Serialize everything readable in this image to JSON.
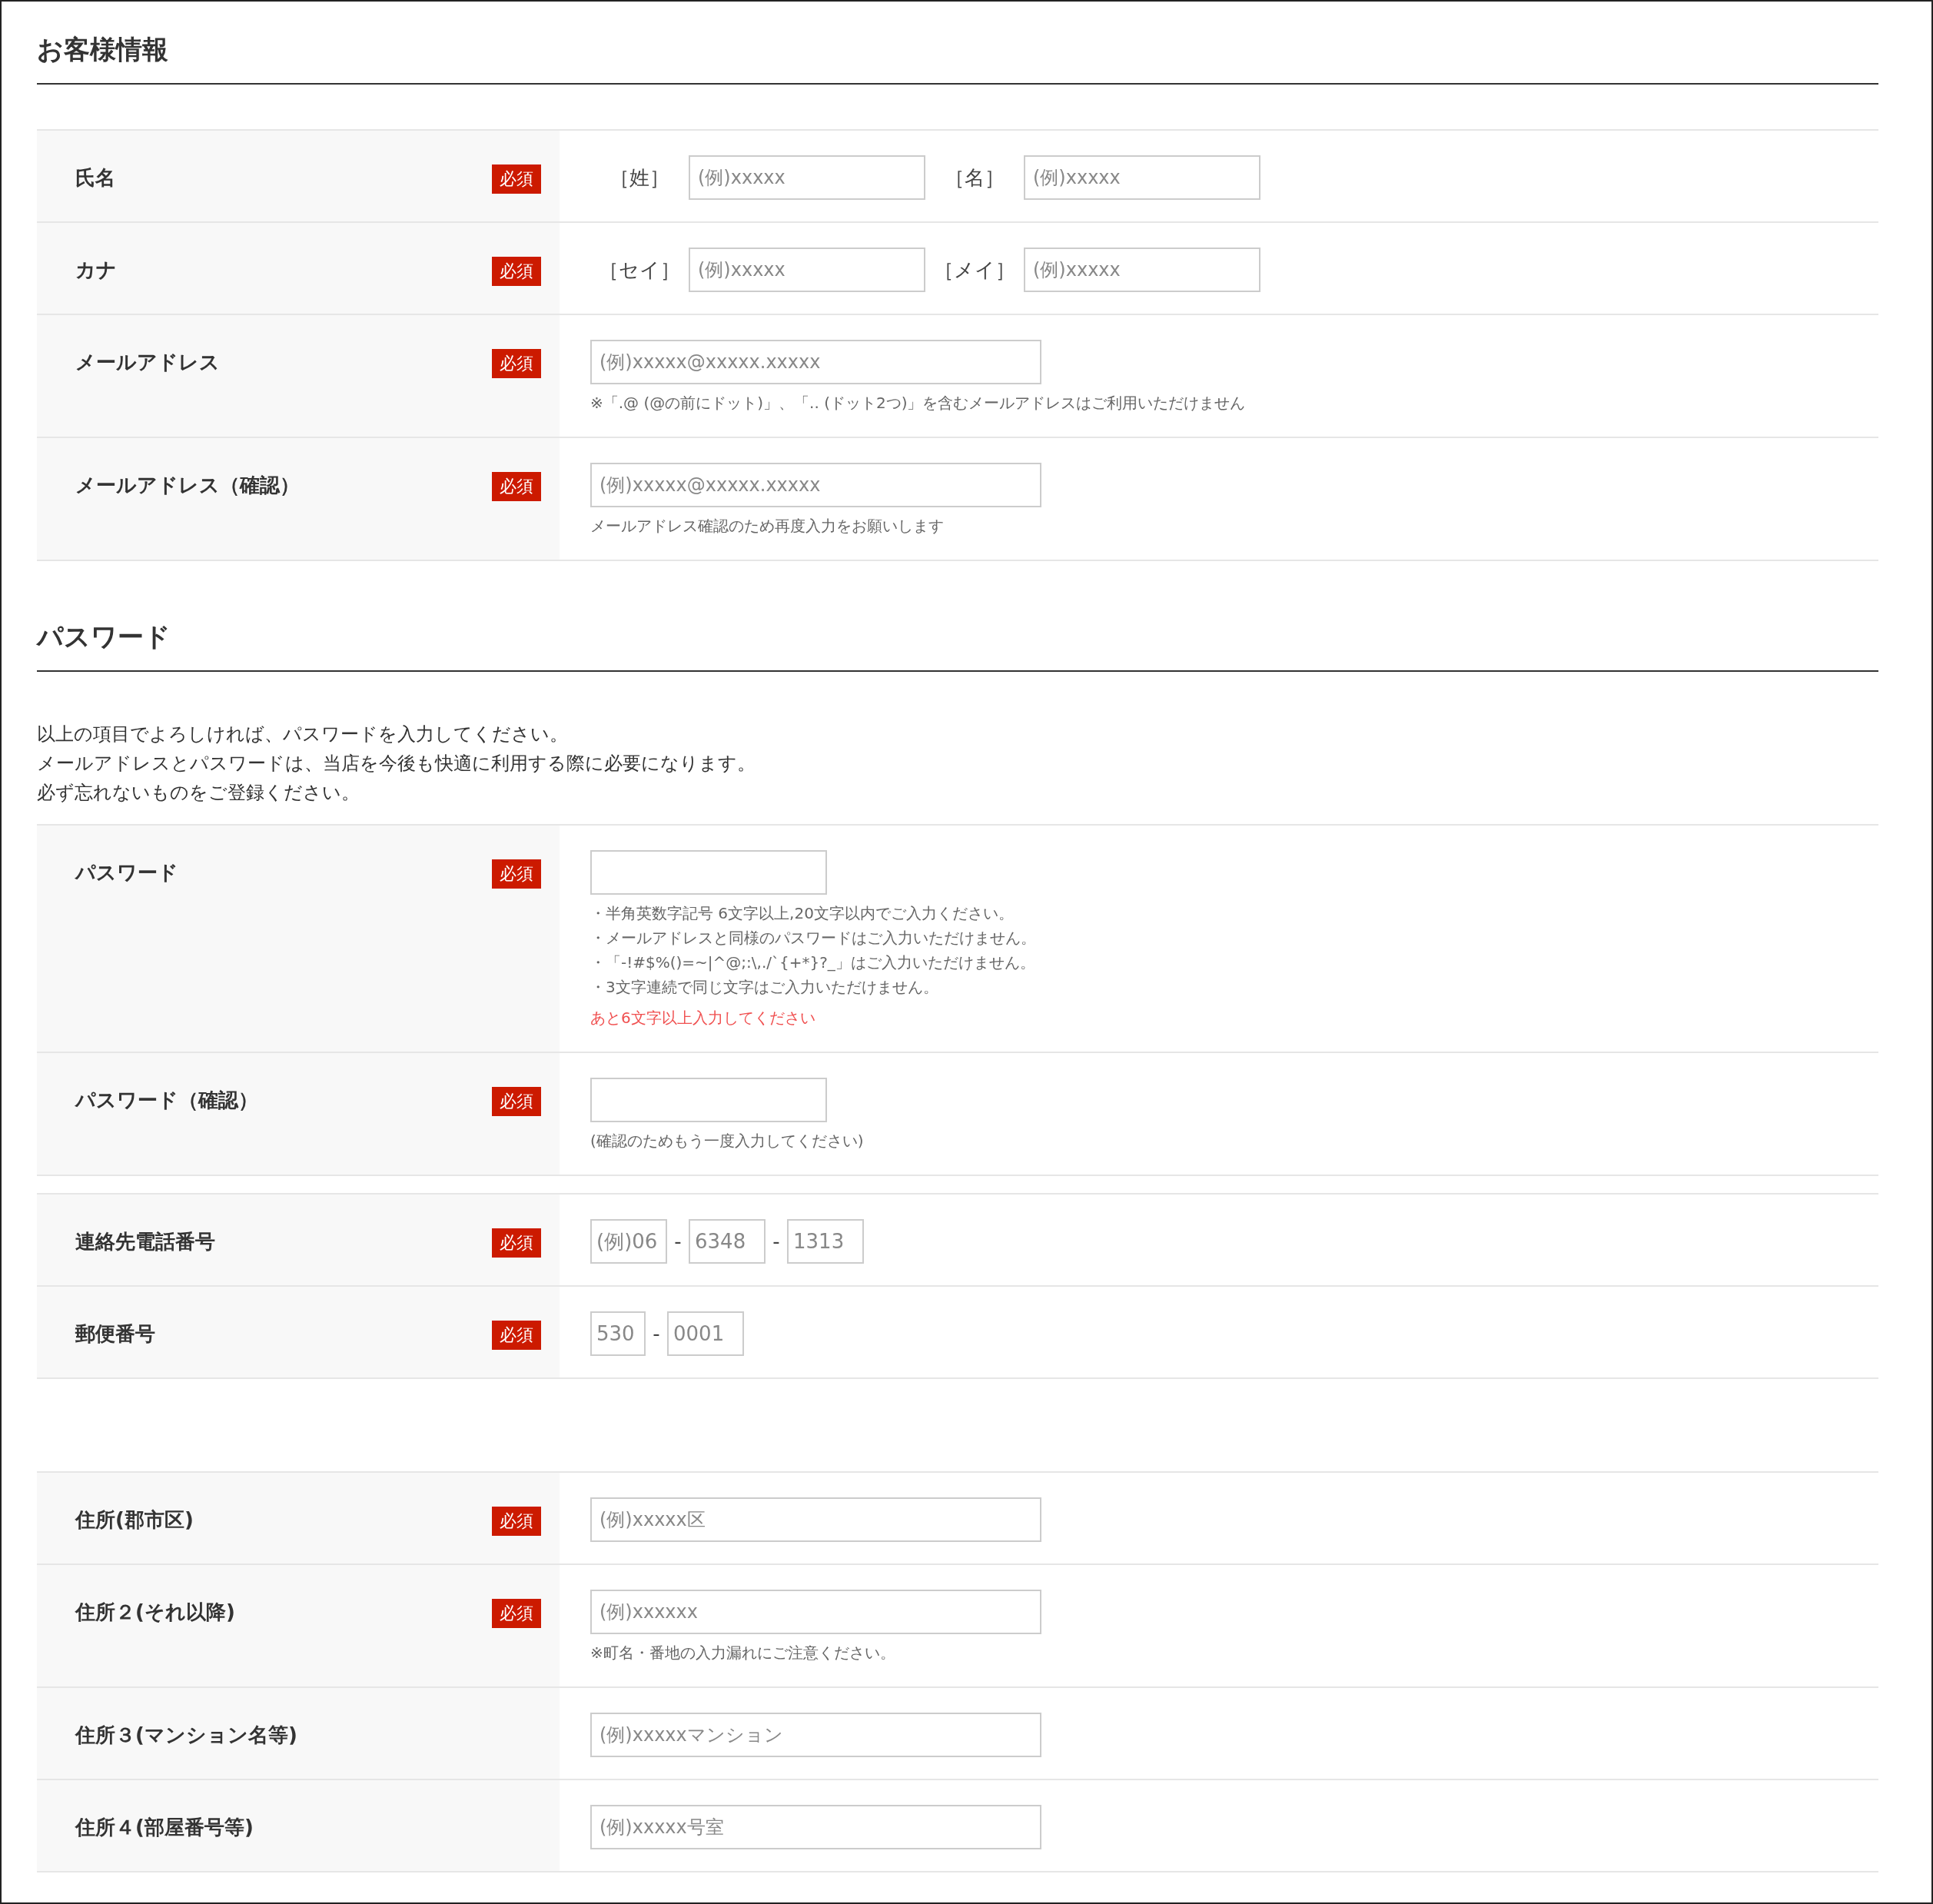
{
  "sections": [
    {
      "heading": "お客様情報",
      "groups": [
        {
          "rows": [
            {
              "label": "氏名",
              "badge": "必須",
              "items": [
                {
                  "kind": "prefix",
                  "text": "［姓］"
                },
                {
                  "kind": "medium",
                  "placeholder": "(例)xxxxx"
                },
                {
                  "kind": "prefix",
                  "text": "［名］"
                },
                {
                  "kind": "medium",
                  "placeholder": "(例)xxxxx"
                }
              ]
            },
            {
              "label": "カナ",
              "badge": "必須",
              "items": [
                {
                  "kind": "prefix",
                  "text": "［セイ］"
                },
                {
                  "kind": "medium",
                  "placeholder": "(例)xxxxx"
                },
                {
                  "kind": "prefix",
                  "text": "［メイ］"
                },
                {
                  "kind": "medium",
                  "placeholder": "(例)xxxxx"
                }
              ]
            },
            {
              "label": "メールアドレス",
              "badge": "必須",
              "items": [
                {
                  "kind": "wide",
                  "placeholder": "(例)xxxxx@xxxxx.xxxxx"
                }
              ],
              "notes": [
                {
                  "kind": "note",
                  "text": "※「.@ (@の前にドット)」、「.. (ドット2つ)」を含むメールアドレスはご利用いただけません"
                }
              ]
            },
            {
              "label": "メールアドレス（確認）",
              "badge": "必須",
              "items": [
                {
                  "kind": "wide",
                  "placeholder": "(例)xxxxx@xxxxx.xxxxx"
                }
              ],
              "notes": [
                {
                  "kind": "note",
                  "text": "メールアドレス確認のため再度入力をお願いします"
                }
              ]
            }
          ]
        }
      ]
    },
    {
      "heading": "パスワード",
      "intro": [
        "以上の項目でよろしければ、パスワードを入力してください。",
        "メールアドレスとパスワードは、当店を今後も快適に利用する際に必要になります。",
        "必ず忘れないものをご登録ください。"
      ],
      "groups": [
        {
          "rows": [
            {
              "label": "パスワード",
              "badge": "必須",
              "items": [
                {
                  "kind": "medium"
                }
              ],
              "notes": [
                {
                  "kind": "note",
                  "text": "・半角英数字記号 6文字以上,20文字以内でご入力ください。"
                },
                {
                  "kind": "note",
                  "text": "・メールアドレスと同様のパスワードはご入力いただけません。"
                },
                {
                  "kind": "note",
                  "text": "・「-!#$%()=~|^@;:\\,./`{+*}?_」はご入力いただけません。"
                },
                {
                  "kind": "note",
                  "text": "・3文字連続で同じ文字はご入力いただけません。"
                },
                {
                  "kind": "error",
                  "text": "あと6文字以上入力してください"
                }
              ]
            },
            {
              "label": "パスワード（確認）",
              "badge": "必須",
              "items": [
                {
                  "kind": "medium"
                }
              ],
              "notes": [
                {
                  "kind": "note",
                  "text": "(確認のためもう一度入力してください)"
                }
              ]
            }
          ]
        },
        {
          "rows": [
            {
              "label": "連絡先電話番号",
              "badge": "必須",
              "items": [
                {
                  "kind": "short",
                  "placeholder": "(例)06"
                },
                {
                  "kind": "sep",
                  "text": "-"
                },
                {
                  "kind": "short",
                  "placeholder": "6348"
                },
                {
                  "kind": "sep",
                  "text": "-"
                },
                {
                  "kind": "short",
                  "placeholder": "1313"
                }
              ]
            },
            {
              "label": "郵便番号",
              "badge": "必須",
              "items": [
                {
                  "kind": "tiny",
                  "placeholder": "530"
                },
                {
                  "kind": "sep",
                  "text": "-"
                },
                {
                  "kind": "short",
                  "placeholder": "0001"
                }
              ]
            }
          ]
        }
      ]
    },
    {
      "groups": [
        {
          "rows": [
            {
              "label": "住所(郡市区)",
              "badge": "必須",
              "items": [
                {
                  "kind": "wide",
                  "placeholder": "(例)xxxxx区"
                }
              ]
            },
            {
              "label": "住所２(それ以降)",
              "badge": "必須",
              "items": [
                {
                  "kind": "wide",
                  "placeholder": "(例)xxxxxx"
                }
              ],
              "notes": [
                {
                  "kind": "note",
                  "text": "※町名・番地の入力漏れにご注意ください。"
                }
              ]
            },
            {
              "label": "住所３(マンション名等)",
              "items": [
                {
                  "kind": "wide",
                  "placeholder": "(例)xxxxxマンション"
                }
              ]
            },
            {
              "label": "住所４(部屋番号等)",
              "items": [
                {
                  "kind": "wide",
                  "placeholder": "(例)xxxxx号室"
                }
              ]
            }
          ]
        }
      ]
    }
  ]
}
